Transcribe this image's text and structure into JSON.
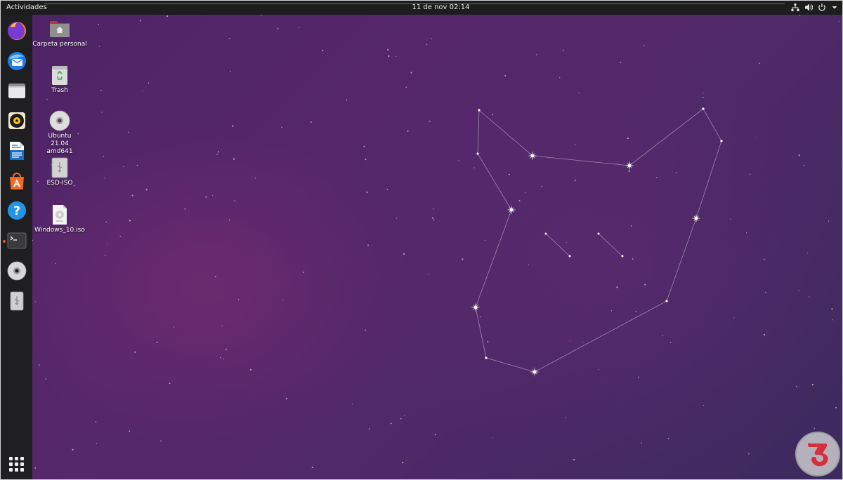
{
  "topbar": {
    "activities_label": "Actividades",
    "clock": "11 de nov  02:14",
    "tray_icons": [
      "network-icon",
      "volume-icon",
      "power-icon",
      "chevron-down-icon"
    ]
  },
  "dock": {
    "items": [
      {
        "name": "firefox-icon"
      },
      {
        "name": "thunderbird-icon"
      },
      {
        "name": "files-icon"
      },
      {
        "name": "rhythmbox-icon"
      },
      {
        "name": "libreoffice-writer-icon"
      },
      {
        "name": "software-center-icon"
      },
      {
        "name": "help-icon"
      },
      {
        "name": "terminal-icon",
        "running": true
      },
      {
        "name": "dvd-disc-icon"
      },
      {
        "name": "usb-drive-icon"
      }
    ],
    "show_apps": "apps-grid-icon"
  },
  "desktop": {
    "icons": [
      {
        "label": "Carpeta personal",
        "icon": "home-folder-icon"
      },
      {
        "label": "Trash",
        "icon": "trash-icon"
      },
      {
        "label": "Ubuntu 21.04 amd641",
        "icon": "disc-icon"
      },
      {
        "label": "ESD-ISO",
        "icon": "usb-drive-icon"
      },
      {
        "label": "Windows_10.iso",
        "icon": "iso-file-icon"
      }
    ]
  },
  "colors": {
    "accent": "#e95420",
    "topbar": "#1d1d1d",
    "dock": "#1f1f22",
    "wallpaper": "#55276a"
  }
}
